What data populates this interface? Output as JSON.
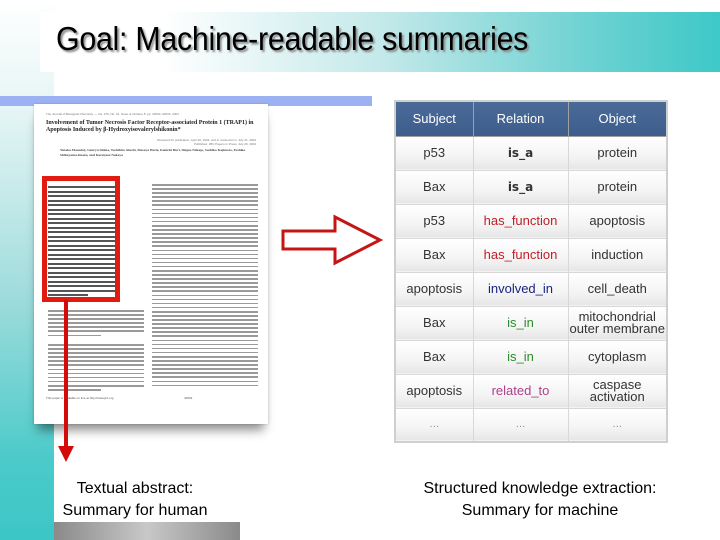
{
  "slide": {
    "title": "Goal:  Machine-readable summaries"
  },
  "document": {
    "journal_line": "The Journal of Biological Chemistry — Vol. 279, No. 41, Issue of October 8, pp. 42503–42515, 2004",
    "paper_title": "Involvement of Tumor Necrosis Factor Receptor-associated Protein 1 (TRAP1) in Apoptosis Induced by β-Hydroxyisovalerylshikonin*",
    "received": "Received for publication, April 29, 2004, and in revised form, July 21, 2004 Published, JBC Papers in Press, July 26, 2004",
    "authors": "Yutaka Masuda‡, Genryu Shima, Toshihiro Aiuchi, Masaya Horie, Kenichi Hori, Shigeo Nakajo, Sachiko Kajimoto, Toshiko Shibayama-Imazu, and Kazuyasu Nakaya",
    "footer": "This paper is available on line at http://www.jbc.org",
    "page_number": "42503"
  },
  "captions": {
    "left_line1": "Textual abstract:",
    "left_line2": "Summary for human",
    "right_line1": "Structured knowledge extraction:",
    "right_line2": "Summary for machine"
  },
  "table": {
    "headers": [
      "Subject",
      "Relation",
      "Object"
    ],
    "relation_colors": {
      "is_a": "#333333",
      "has_function": "#c0202a",
      "involved_in": "#1a237e",
      "is_in": "#2e8b2e",
      "related_to": "#b0408a",
      "ellipsis": "#888888"
    },
    "rows": [
      {
        "subject": "p53",
        "relation": "is_a",
        "object": "protein",
        "kind": "is_a"
      },
      {
        "subject": "Bax",
        "relation": "is_a",
        "object": "protein",
        "kind": "is_a"
      },
      {
        "subject": "p53",
        "relation": "has_function",
        "object": "apoptosis",
        "kind": "has_function"
      },
      {
        "subject": "Bax",
        "relation": "has_function",
        "object": "induction",
        "kind": "has_function"
      },
      {
        "subject": "apoptosis",
        "relation": "involved_in",
        "object": "cell_death",
        "kind": "involved_in"
      },
      {
        "subject": "Bax",
        "relation": "is_in",
        "object": "mitochondrial outer membrane",
        "kind": "is_in"
      },
      {
        "subject": "Bax",
        "relation": "is_in",
        "object": "cytoplasm",
        "kind": "is_in"
      },
      {
        "subject": "apoptosis",
        "relation": "related_to",
        "object": "caspase activation",
        "kind": "related_to"
      },
      {
        "subject": "…",
        "relation": "…",
        "object": "…",
        "kind": "ellipsis"
      }
    ]
  },
  "icons": {
    "abstract_highlight": "red-rectangle",
    "down_arrow": "red-down-arrow",
    "right_arrow": "red-outline-right-arrow"
  },
  "colors": {
    "accent_teal": "#3ec8c8",
    "header_blue": "#3d5d8c",
    "arrow_red": "#d40b0b",
    "bar_blue": "#9cb0f4"
  }
}
